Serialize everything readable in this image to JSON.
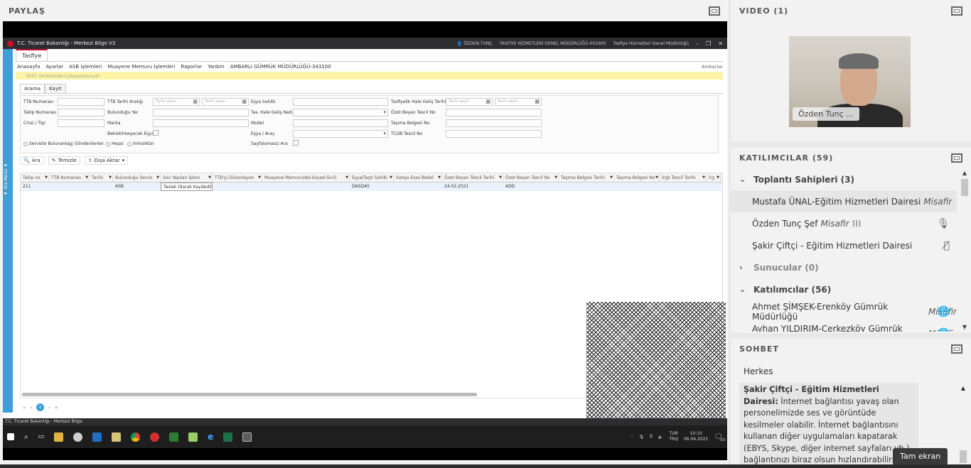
{
  "share": {
    "title": "PAYLAŞ",
    "remote": {
      "titlebar": {
        "app_title": "T.C. Ticaret Bakanlığı - Merkezi Bilge V3",
        "user": "ÖZDEN TUNÇ",
        "dept1": "TASFİYE HİZMETLERİ GENEL MÜDÜRLÜĞÜ-001600",
        "dept2": "Tasfiye Hizmetleri Genel Müdürlüğü"
      },
      "side_strip_label": "◄ Ara Menü ◄",
      "tab": "Tasfiye",
      "menu": [
        "Anasayfa",
        "Ayarlar",
        "ASB İşlemleri",
        "Muayene Memuru İşlemleri",
        "Raporlar",
        "Yardım",
        "AMBARLI GÜMRÜK MÜDÜRLÜĞÜ-343100"
      ],
      "menu_right": "Ambarlar",
      "warning": "TEST Ortamında Çalışıyorsunuz!",
      "subtabs": [
        "Arama",
        "Kayıt"
      ],
      "form": {
        "ttb_no": "TTB Numarası",
        "takip_no": "Takip Numarası",
        "cins": "Cinsi / Tipi",
        "ttb_tarih": "TTB Tarihi Aralığı",
        "bulundugu_yer": "Bulunduğu Yer",
        "marka": "Marka",
        "bekletilmeyecek": "Bekletilmeyecek Eşya",
        "esya_sahibi": "Eşya Sahibi",
        "tas_hale_gelis": "Tas. Hale Geliş Ned.",
        "model": "Model",
        "esya_arac": "Eşya / Araç",
        "sayfalamasiz": "Sayfalamasız Ara",
        "tasfiyelik_tarih": "Tasfiyelik Hale Geliş Tarihi",
        "ozet_beyan": "Özet Beyan Tescil No",
        "tasima_belgesi": "Taşıma Belgesi No",
        "tcgb": "TCGB Tescil No",
        "date_placeholder": "Tarih seçin",
        "radio_servis": "Serviste Bulunanlar",
        "radio_gonderilen": "Gönderilenler",
        "radio_hepsi": "Hepsi",
        "radio_imha": "İmhalıklar"
      },
      "actions": {
        "search": "Ara",
        "clear": "Temizle",
        "export": "Dışa Aktar"
      },
      "grid": {
        "columns": [
          "Takip no",
          "TTB Numarası",
          "Tarihi",
          "Bulunduğu Servis",
          "Son Yapılan İşlem",
          "TTB'yi Düzenleyen",
          "Muayene Memuru(Ad-Soyad-Sicil)",
          "Eşya/Taşıt Sahibi",
          "Satışa Esas Bedel",
          "Özet Beyan Tescil Tarihi",
          "Özet Beyan Tescil No",
          "Taşıma Belgesi Tarihi",
          "Taşıma Belgesi No",
          "İrgb Tescil Tarihi",
          "İrg"
        ],
        "rows": [
          [
            "211",
            "",
            "",
            "ASB",
            "Taslak Olarak Kaydedildi",
            "",
            "",
            "DASDAS",
            "",
            "24.02.2021",
            "ADD",
            "",
            "",
            "",
            ""
          ]
        ]
      },
      "pager": {
        "current": "1"
      },
      "taskbar_label": "T.C. Ticaret Bakanlığı - Merkezi Bilge",
      "clock": {
        "lang1": "TUR",
        "lang2": "TRQ",
        "time": "10:10",
        "date": "06.04.2021",
        "notif": "20"
      }
    }
  },
  "video": {
    "title": "VIDEO (1)",
    "name": "Özden Tunç ..."
  },
  "participants": {
    "title": "KATILIMCILAR (59)",
    "sections": [
      {
        "label": "Toplantı Sahipleri (3)",
        "expanded": true,
        "dim": false,
        "members": [
          {
            "name": "Mustafa ÜNAL-Eğitim Hizmetleri Dairesi",
            "role": "Misafir",
            "icon": "",
            "highlight": true
          },
          {
            "name": "Özden Tunç Şef",
            "role": "Misafir",
            "icon": "mic-icon",
            "speaking": true
          },
          {
            "name": "Şakir Çiftçi - Eğitim Hizmetleri Dairesi",
            "role": "",
            "icon": "mic-off-icon"
          }
        ]
      },
      {
        "label": "Sunucular (0)",
        "expanded": false,
        "dim": true,
        "members": []
      },
      {
        "label": "Katılımcılar (56)",
        "expanded": true,
        "dim": false,
        "members": [
          {
            "name": "Ahmet ŞİMŞEK-Erenköy Gümrük Müdürlüğü",
            "role": "Misafir",
            "icon": "globe-icon"
          },
          {
            "name": "Ayhan YILDIRIM-Çerkezköy Gümrük Müdü...",
            "role": "Misafir",
            "icon": "globe-icon"
          }
        ]
      }
    ]
  },
  "chat": {
    "title": "SOHBET",
    "to": "Herkes",
    "sender": "Şakir Çiftçi - Eğitim Hizmetleri Dairesi:",
    "message": " İnternet bağlantısı yavaş olan personelimizde ses ve görüntüde kesilmeler olabilir. İnternet bağlantısını kullanan diğer uygulamaları kapatarak (EBYS, Skype, diğer internet sayfaları vb.) bağlantınızı biraz olsun hızlandırabilirsiniz."
  },
  "tooltip": "Tam ekran"
}
